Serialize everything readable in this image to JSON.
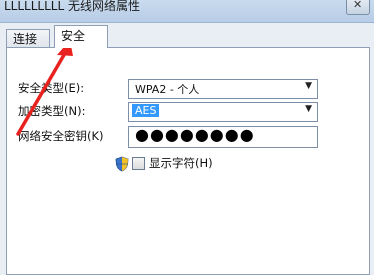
{
  "window": {
    "title": "LLLLLLLLL 无线网络属性",
    "close_glyph": "✕"
  },
  "tabs": [
    {
      "label": "连接",
      "active": false
    },
    {
      "label": "安全",
      "active": true
    }
  ],
  "form": {
    "security_type": {
      "label": "安全类型(E):",
      "value": "WPA2 - 个人"
    },
    "encryption_type": {
      "label": "加密类型(N):",
      "value": "AES"
    },
    "network_key": {
      "label": "网络安全密钥(K)",
      "masked_value": "●●●●●●●●"
    },
    "show_chars": {
      "label": "显示字符(H)",
      "checked": false
    }
  },
  "icons": {
    "shield": "uac-shield-icon",
    "dropdown_arrow": "▼"
  },
  "annotation": {
    "arrow_color": "#e8231f"
  }
}
